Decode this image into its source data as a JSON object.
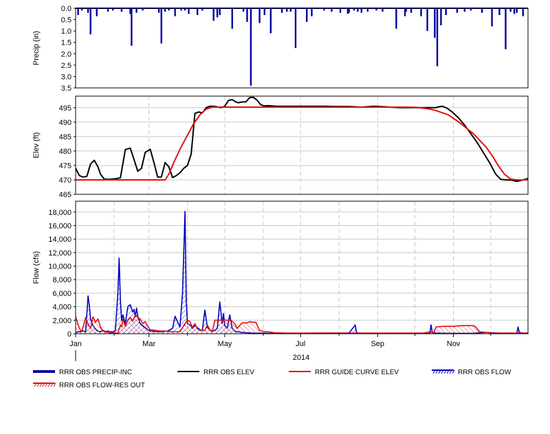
{
  "chart_data": [
    {
      "type": "bar",
      "panel": "precip",
      "ylabel": "Precip (in)",
      "yticks": [
        "0.0",
        "0.5",
        "1.0",
        "1.5",
        "2.0",
        "2.5",
        "3.0",
        "3.5"
      ],
      "ylim": [
        3.5,
        0.0
      ],
      "inverted_y": true,
      "grid": false,
      "x_unit": "day-of-year 2014",
      "series": [
        {
          "name": "RRR OBS PRECIP-INC",
          "color": "#0000a0",
          "x": [
            2,
            5,
            10,
            12,
            17,
            26,
            30,
            37,
            44,
            45,
            49,
            54,
            67,
            69,
            72,
            75,
            80,
            85,
            88,
            91,
            98,
            102,
            111,
            114,
            116,
            126,
            135,
            138,
            141,
            148,
            152,
            157,
            166,
            170,
            173,
            177,
            186,
            190,
            200,
            206,
            213,
            219,
            220,
            224,
            227,
            230,
            235,
            242,
            247,
            258,
            265,
            266,
            270,
            278,
            283,
            289,
            291,
            294,
            298,
            307,
            313,
            318,
            327,
            335,
            341,
            346,
            350,
            353,
            355,
            360
          ],
          "values": [
            0.3,
            0.1,
            0.2,
            1.15,
            0.35,
            0.15,
            0.1,
            0.15,
            0.25,
            1.65,
            0.2,
            0.1,
            0.2,
            1.55,
            0.15,
            0.1,
            0.35,
            0.1,
            0.1,
            0.25,
            0.3,
            0.1,
            0.55,
            0.4,
            0.3,
            0.9,
            0.15,
            0.6,
            3.4,
            0.65,
            0.3,
            1.1,
            0.2,
            0.15,
            0.15,
            1.75,
            0.6,
            0.35,
            0.1,
            0.15,
            0.2,
            0.25,
            0.2,
            0.1,
            0.15,
            0.2,
            0.15,
            0.1,
            0.15,
            0.9,
            0.35,
            0.15,
            0.2,
            0.35,
            1.0,
            1.3,
            2.55,
            0.75,
            0.3,
            0.2,
            0.15,
            0.1,
            0.2,
            0.8,
            0.3,
            1.8,
            0.15,
            0.25,
            0.2,
            0.35
          ]
        }
      ]
    },
    {
      "type": "line",
      "panel": "elev",
      "ylabel": "Elev (ft)",
      "yticks": [
        "465",
        "470",
        "475",
        "480",
        "485",
        "490",
        "495"
      ],
      "ylim": [
        465,
        499
      ],
      "grid": true,
      "series": [
        {
          "name": "RRR OBS ELEV",
          "color": "#000000",
          "x": [
            0,
            3,
            6,
            9,
            12,
            15,
            18,
            20,
            23,
            27,
            32,
            36,
            40,
            44,
            47,
            50,
            53,
            56,
            60,
            63,
            66,
            69,
            72,
            75,
            78,
            81,
            84,
            87,
            90,
            93,
            96,
            99,
            102,
            105,
            108,
            111,
            114,
            117,
            120,
            123,
            126,
            128,
            131,
            134,
            137,
            140,
            143,
            146,
            149,
            152,
            155,
            158,
            162,
            166,
            170,
            175,
            180,
            190,
            200,
            210,
            220,
            230,
            240,
            250,
            260,
            270,
            280,
            285,
            290,
            292,
            295,
            299,
            303,
            308,
            313,
            318,
            323,
            328,
            333,
            338,
            342,
            346,
            350,
            355,
            360,
            364
          ],
          "values": [
            474,
            471.5,
            471,
            471.2,
            475.5,
            476.8,
            474.5,
            472,
            470.3,
            470.2,
            470.4,
            470.7,
            480.5,
            481,
            477,
            473,
            474,
            479.5,
            480.6,
            476,
            471,
            471,
            476,
            474.5,
            470.8,
            471.5,
            472.5,
            474,
            475,
            479,
            493,
            493.5,
            493.2,
            495,
            495.5,
            495.5,
            495.3,
            495,
            495.5,
            497.5,
            497.8,
            497.2,
            496.7,
            497,
            497,
            498.5,
            498.6,
            497.6,
            496,
            495.6,
            495.7,
            495.6,
            495.5,
            495.5,
            495.5,
            495.5,
            495.5,
            495.5,
            495.5,
            495.4,
            495.4,
            495.2,
            495.5,
            495.3,
            495,
            495,
            495,
            495,
            495,
            495.3,
            495.5,
            494.8,
            493.5,
            491.5,
            489,
            486,
            483,
            479.5,
            476,
            472,
            470.2,
            470,
            470,
            469.5,
            470,
            470.5
          ]
        },
        {
          "name": "RRR GUIDE CURVE ELEV",
          "color": "#e01010",
          "x": [
            0,
            72,
            75,
            80,
            85,
            90,
            95,
            100,
            105,
            110,
            115,
            150,
            200,
            245,
            255,
            265,
            275,
            285,
            290,
            300,
            310,
            320,
            330,
            335,
            340,
            345,
            350,
            355,
            360,
            364
          ],
          "values": [
            470,
            470,
            472,
            477,
            481.5,
            485.5,
            489.5,
            492.5,
            494.5,
            495.2,
            495.2,
            495.2,
            495.2,
            495.2,
            495.2,
            495.2,
            495.1,
            494.5,
            494,
            492.5,
            489.5,
            486,
            481.5,
            478.5,
            475,
            472,
            470.3,
            470,
            470,
            470
          ]
        }
      ]
    },
    {
      "type": "line",
      "panel": "flow",
      "ylabel": "Flow (cfs)",
      "yticks": [
        "0",
        "2,000",
        "4,000",
        "6,000",
        "8,000",
        "10,000",
        "12,000",
        "14,000",
        "16,000",
        "18,000"
      ],
      "ylim": [
        0,
        19600
      ],
      "grid": true,
      "xticks": [
        "Jan",
        "Mar",
        "May",
        "Jul",
        "Sep",
        "Nov"
      ],
      "xtick_days": [
        0,
        59,
        120,
        181,
        243,
        304
      ],
      "x_year_label": "2014",
      "series": [
        {
          "name": "RRR OBS FLOW",
          "color": "#0000c0",
          "x": [
            0,
            3,
            6,
            8,
            10,
            11,
            12,
            14,
            16,
            18,
            20,
            22,
            24,
            26,
            28,
            30,
            32,
            34,
            35,
            36,
            37,
            38,
            40,
            42,
            44,
            46,
            47,
            48,
            49,
            50,
            52,
            54,
            56,
            58,
            60,
            62,
            64,
            66,
            68,
            70,
            74,
            78,
            80,
            84,
            86,
            88,
            89,
            90,
            92,
            94,
            96,
            100,
            102,
            104,
            106,
            108,
            110,
            112,
            114,
            116,
            118,
            119,
            120,
            122,
            124,
            126,
            128,
            130,
            134,
            138,
            142,
            150,
            160,
            170,
            180,
            190,
            200,
            210,
            220,
            225,
            226,
            227,
            230,
            240,
            250,
            260,
            270,
            280,
            285,
            286,
            287,
            290,
            300,
            310,
            320,
            330,
            340,
            350,
            355,
            356,
            357,
            360,
            364
          ],
          "values": [
            200,
            300,
            400,
            300,
            5600,
            4200,
            2200,
            1200,
            700,
            400,
            300,
            500,
            300,
            400,
            300,
            250,
            500,
            6000,
            11200,
            5000,
            2000,
            2800,
            1500,
            4000,
            4300,
            3200,
            3600,
            2500,
            3800,
            2600,
            1500,
            1200,
            900,
            600,
            400,
            400,
            300,
            350,
            300,
            300,
            400,
            800,
            2600,
            1000,
            6000,
            18100,
            5000,
            1500,
            1300,
            800,
            1200,
            600,
            500,
            3500,
            1000,
            600,
            400,
            500,
            800,
            4700,
            1500,
            3000,
            1200,
            800,
            2800,
            800,
            400,
            300,
            200,
            150,
            100,
            80,
            60,
            60,
            60,
            80,
            100,
            100,
            100,
            1300,
            200,
            100,
            80,
            60,
            60,
            60,
            50,
            50,
            50,
            1300,
            200,
            80,
            60,
            60,
            60,
            200,
            100,
            80,
            60,
            1000,
            200,
            100,
            100
          ]
        },
        {
          "name": "RRR OBS FLOW-RES OUT",
          "color": "#e01010",
          "x": [
            0,
            3,
            5,
            8,
            10,
            12,
            14,
            16,
            18,
            20,
            22,
            25,
            28,
            30,
            32,
            34,
            36,
            37,
            38,
            40,
            42,
            44,
            46,
            48,
            50,
            52,
            54,
            56,
            58,
            60,
            64,
            68,
            72,
            76,
            80,
            84,
            88,
            90,
            92,
            94,
            96,
            98,
            100,
            104,
            106,
            108,
            110,
            112,
            115,
            120,
            125,
            128,
            130,
            134,
            138,
            140,
            143,
            145,
            148,
            152,
            155,
            160,
            170,
            180,
            190,
            200,
            210,
            220,
            230,
            240,
            250,
            260,
            270,
            280,
            285,
            288,
            290,
            296,
            300,
            305,
            310,
            315,
            320,
            322,
            325,
            330,
            335,
            340,
            350,
            360,
            364
          ],
          "values": [
            2500,
            800,
            300,
            2400,
            1400,
            800,
            2500,
            1700,
            2200,
            1000,
            400,
            200,
            100,
            150,
            100,
            100,
            1300,
            1000,
            2200,
            1100,
            2000,
            2400,
            1900,
            2800,
            2400,
            2200,
            1500,
            1800,
            1100,
            600,
            500,
            400,
            400,
            300,
            300,
            300,
            1500,
            2000,
            1800,
            900,
            1500,
            700,
            500,
            500,
            1300,
            600,
            300,
            2000,
            2000,
            2000,
            2000,
            1500,
            800,
            1600,
            1600,
            1800,
            1700,
            1700,
            500,
            300,
            300,
            150,
            100,
            100,
            100,
            100,
            100,
            100,
            100,
            100,
            100,
            100,
            100,
            100,
            300,
            100,
            1000,
            1100,
            1100,
            1100,
            1200,
            1200,
            1200,
            1000,
            300,
            200,
            100,
            100,
            100,
            100,
            100
          ]
        }
      ]
    }
  ],
  "legend": [
    {
      "name": "RRR OBS PRECIP-INC",
      "color": "#0000a0",
      "style": "thick-line"
    },
    {
      "name": "RRR OBS ELEV",
      "color": "#000000",
      "style": "line"
    },
    {
      "name": "RRR GUIDE CURVE ELEV",
      "color": "#e01010",
      "style": "line"
    },
    {
      "name": "RRR OBS FLOW",
      "color": "#0000c0",
      "style": "hatched"
    },
    {
      "name": "RRR OBS FLOW-RES OUT",
      "color": "#e01010",
      "style": "hatched"
    }
  ]
}
